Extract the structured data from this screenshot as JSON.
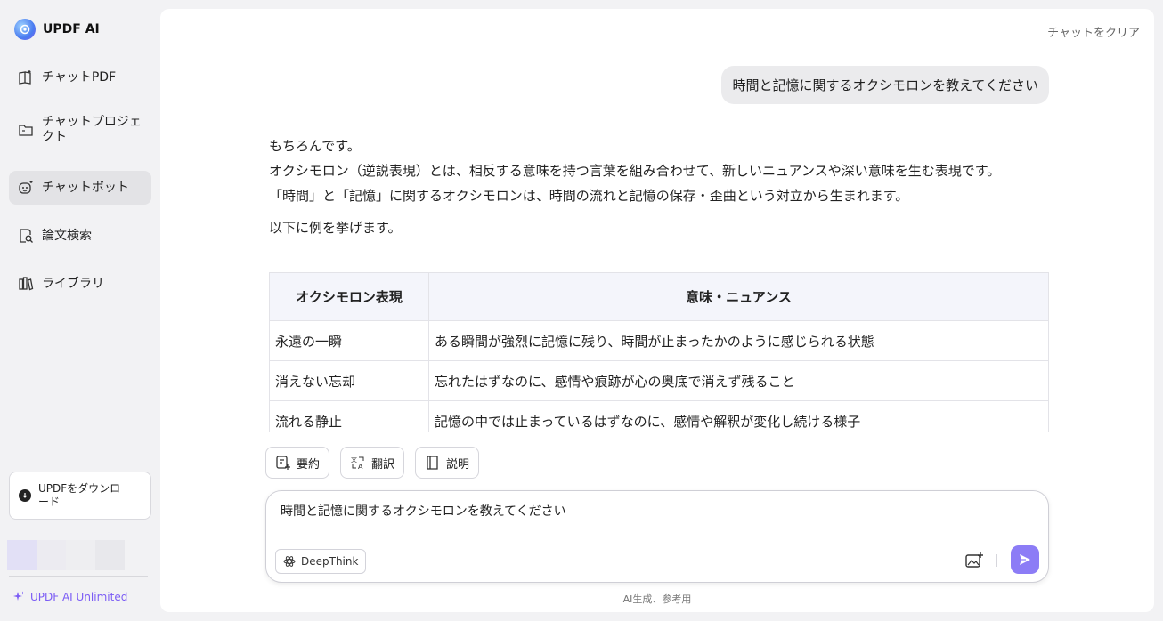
{
  "brand": {
    "name": "UPDF AI"
  },
  "sidebar": {
    "items": [
      {
        "label": "チャットPDF",
        "icon": "book-chat-icon"
      },
      {
        "label": "チャットプロジェクト",
        "icon": "folder-icon"
      },
      {
        "label": "チャットボット",
        "icon": "bot-icon"
      },
      {
        "label": "論文検索",
        "icon": "doc-search-icon"
      },
      {
        "label": "ライブラリ",
        "icon": "library-icon"
      }
    ],
    "active_index": 2,
    "download_label": "UPDFをダウンロード",
    "unlimited_label": "UPDF AI Unlimited"
  },
  "header": {
    "clear_chat": "チャットをクリア"
  },
  "chat": {
    "user_message": "時間と記憶に関するオクシモロンを教えてください",
    "answer": {
      "p1": "もちろんです。",
      "p2": "オクシモロン（逆説表現）とは、相反する意味を持つ言葉を組み合わせて、新しいニュアンスや深い意味を生む表現です。",
      "p3": "「時間」と「記憶」に関するオクシモロンは、時間の流れと記憶の保存・歪曲という対立から生まれます。",
      "p4": "以下に例を挙げます。"
    },
    "table": {
      "headers": [
        "オクシモロン表現",
        "意味・ニュアンス"
      ],
      "rows": [
        [
          "永遠の一瞬",
          "ある瞬間が強烈に記憶に残り、時間が止まったかのように感じられる状態"
        ],
        [
          "消えない忘却",
          "忘れたはずなのに、感情や痕跡が心の奥底で消えず残ること"
        ],
        [
          "流れる静止",
          "記憶の中では止まっているはずなのに、感情や解釈が変化し続ける様子"
        ]
      ]
    }
  },
  "tools": {
    "summarize": "要約",
    "translate": "翻訳",
    "explain": "説明"
  },
  "composer": {
    "value": "時間と記憶に関するオクシモロンを教えてください",
    "deepthink_label": "DeepThink"
  },
  "footer": {
    "note": "AI生成、参考用"
  },
  "colors": {
    "accent": "#8c7cf6",
    "unlimited": "#7b5cf5",
    "active_nav": "#e3e3e6"
  }
}
